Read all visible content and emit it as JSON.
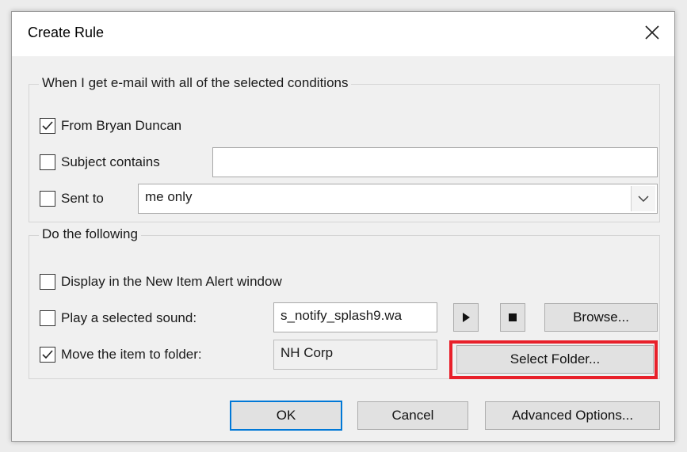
{
  "dialog": {
    "title": "Create Rule"
  },
  "conditions": {
    "legend": "When I get e-mail with all of the selected conditions",
    "from": {
      "label": "From Bryan Duncan",
      "checked": true
    },
    "subject": {
      "label": "Subject contains",
      "checked": false,
      "value": ""
    },
    "sent_to": {
      "label": "Sent to",
      "checked": false,
      "value": "me only"
    }
  },
  "actions": {
    "legend": "Do the following",
    "alert": {
      "label": "Display in the New Item Alert window",
      "checked": false
    },
    "sound": {
      "label": "Play a selected sound:",
      "checked": false,
      "value": "s_notify_splash9.wa",
      "browse_label": "Browse..."
    },
    "move": {
      "label": "Move the item to folder:",
      "checked": true,
      "value": "NH Corp",
      "select_label": "Select Folder..."
    }
  },
  "footer": {
    "ok_label": "OK",
    "cancel_label": "Cancel",
    "advanced_label": "Advanced Options..."
  },
  "colors": {
    "highlight": "#e8202a",
    "default_button_border": "#0078d7"
  },
  "icons": {
    "close": "close-icon",
    "play": "play-icon",
    "stop": "stop-icon",
    "dropdown": "chevron-down-icon",
    "check": "checkmark-icon"
  }
}
